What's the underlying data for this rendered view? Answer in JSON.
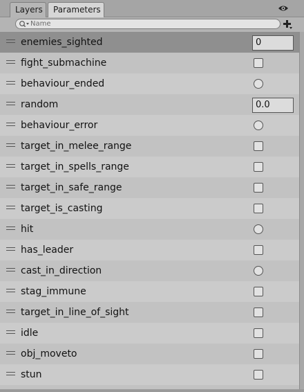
{
  "tabs": {
    "layers": "Layers",
    "parameters": "Parameters"
  },
  "search": {
    "placeholder": "Name"
  },
  "parameters": [
    {
      "name": "enemies_sighted",
      "type": "int",
      "value": "0",
      "selected": true
    },
    {
      "name": "fight_submachine",
      "type": "bool"
    },
    {
      "name": "behaviour_ended",
      "type": "trigger"
    },
    {
      "name": "random",
      "type": "float",
      "value": "0.0"
    },
    {
      "name": "behaviour_error",
      "type": "trigger"
    },
    {
      "name": "target_in_melee_range",
      "type": "bool"
    },
    {
      "name": "target_in_spells_range",
      "type": "bool"
    },
    {
      "name": "target_in_safe_range",
      "type": "bool"
    },
    {
      "name": "target_is_casting",
      "type": "bool"
    },
    {
      "name": "hit",
      "type": "trigger"
    },
    {
      "name": "has_leader",
      "type": "bool"
    },
    {
      "name": "cast_in_direction",
      "type": "trigger"
    },
    {
      "name": "stag_immune",
      "type": "bool"
    },
    {
      "name": "target_in_line_of_sight",
      "type": "bool"
    },
    {
      "name": "idle",
      "type": "bool"
    },
    {
      "name": "obj_moveto",
      "type": "bool"
    },
    {
      "name": "stun",
      "type": "bool"
    }
  ]
}
